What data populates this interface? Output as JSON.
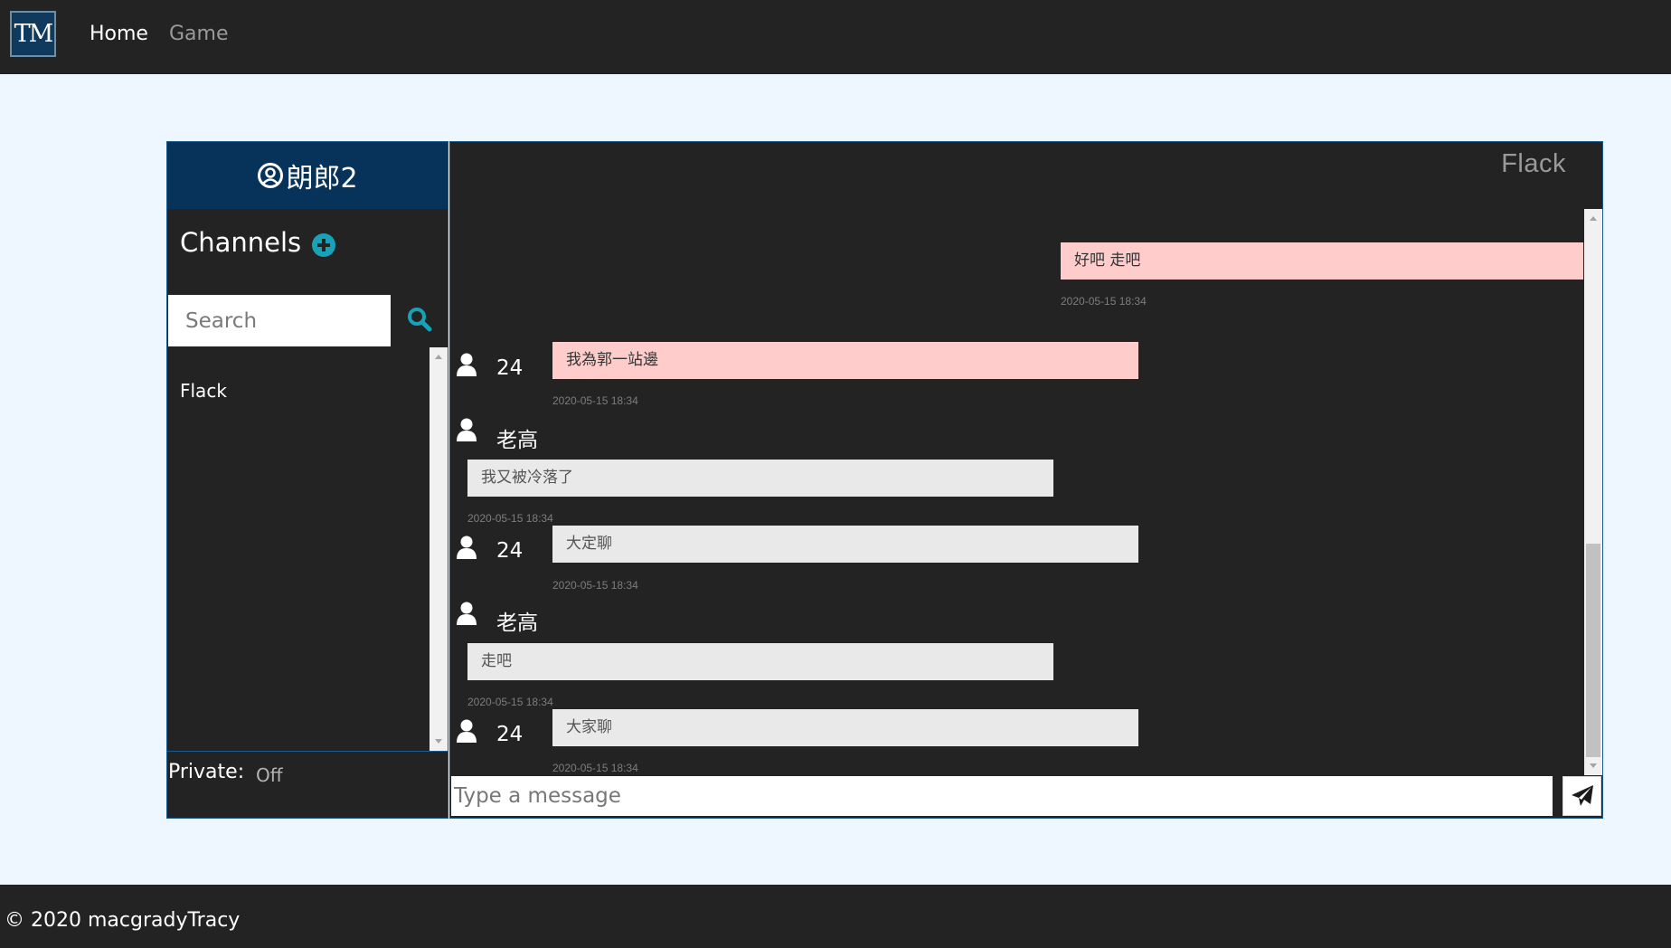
{
  "navbar": {
    "logo_text": "TM",
    "links": [
      {
        "label": "Home",
        "active": true
      },
      {
        "label": "Game",
        "active": false
      }
    ]
  },
  "sidebar": {
    "username": "朗郎2",
    "channels_title": "Channels",
    "search_placeholder": "Search",
    "channels": [
      "Flack"
    ],
    "private_label": "Private:",
    "private_value": "Off"
  },
  "chat": {
    "title": "Flack",
    "input_placeholder": "Type a message",
    "messages": [
      {
        "text": "好吧 走吧",
        "time": "2020-05-15 18:34",
        "own": true
      },
      {
        "sender": "24",
        "text": "我為郭一站邊",
        "time": "2020-05-15 18:34"
      },
      {
        "sender": "老高",
        "text": "我又被冷落了",
        "time": "2020-05-15 18:34"
      },
      {
        "sender": "24",
        "text": "大定聊",
        "time": "2020-05-15 18:34"
      },
      {
        "sender": "老高",
        "text": "走吧",
        "time": "2020-05-15 18:34"
      },
      {
        "sender": "24",
        "text": "大家聊",
        "time": "2020-05-15 18:34"
      }
    ]
  },
  "footer": {
    "text": "© 2020 macgradyTracy"
  },
  "colors": {
    "navbar_bg": "#232323",
    "page_bg": "#eef7ff",
    "sidebar_header_bg": "#07335b",
    "accent": "#17a2b8",
    "own_bubble": "#ffcccc",
    "other_bubble": "#e9e9e9"
  }
}
